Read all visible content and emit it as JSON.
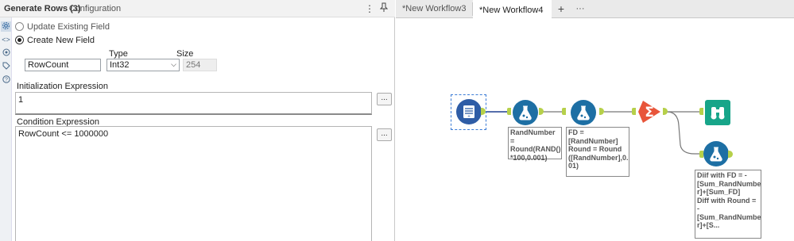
{
  "config": {
    "title": "Generate Rows (3)",
    "subtitle": "- Configuration",
    "header_icons": [
      "kebab-menu-icon",
      "pin-icon"
    ],
    "rail_icons": [
      "gear-icon",
      "code-icon",
      "target-icon",
      "tag-icon",
      "help-icon"
    ],
    "radio_update_label": "Update Existing Field",
    "radio_create_label": "Create New  Field",
    "selected_option": "Create New Field",
    "field_name": "RowCount",
    "type_label": "Type",
    "type_value": "Int32",
    "size_label": "Size",
    "size_value": "254",
    "init_label": "Initialization Expression",
    "init_value": "1",
    "cond_label": "Condition Expression",
    "cond_value": "RowCount <= 1000000",
    "ellipsis": "..."
  },
  "workflow": {
    "tabs": [
      {
        "label": "*New Workflow3",
        "active": false
      },
      {
        "label": "*New Workflow4",
        "active": true
      }
    ],
    "tab_close": "×",
    "add_tab": "+",
    "more_tabs": "···",
    "tools": {
      "generate_rows": "generate-rows-icon",
      "formula": "formula-flask-icon",
      "summarize": "summarize-sigma-icon",
      "browse": "browse-binoculars-icon"
    },
    "notes": {
      "formula1": "RandNumber =\nRound(RAND()\n*100,0.001)",
      "formula2": "FD =\n[RandNumber]\nRound = Round\n([RandNumber],0.\n01)",
      "formula3": "Diif with FD = -\n[Sum_RandNumbe\nr]+[Sum_FD]\nDiff with Round =\n-\n[Sum_RandNumbe\nr]+[S..."
    },
    "colors": {
      "formula": "#1d6fa4",
      "summarize": "#e8553a",
      "browse": "#17a589",
      "anchor": "#b6d04a",
      "connector": "#1f3f8f"
    }
  }
}
